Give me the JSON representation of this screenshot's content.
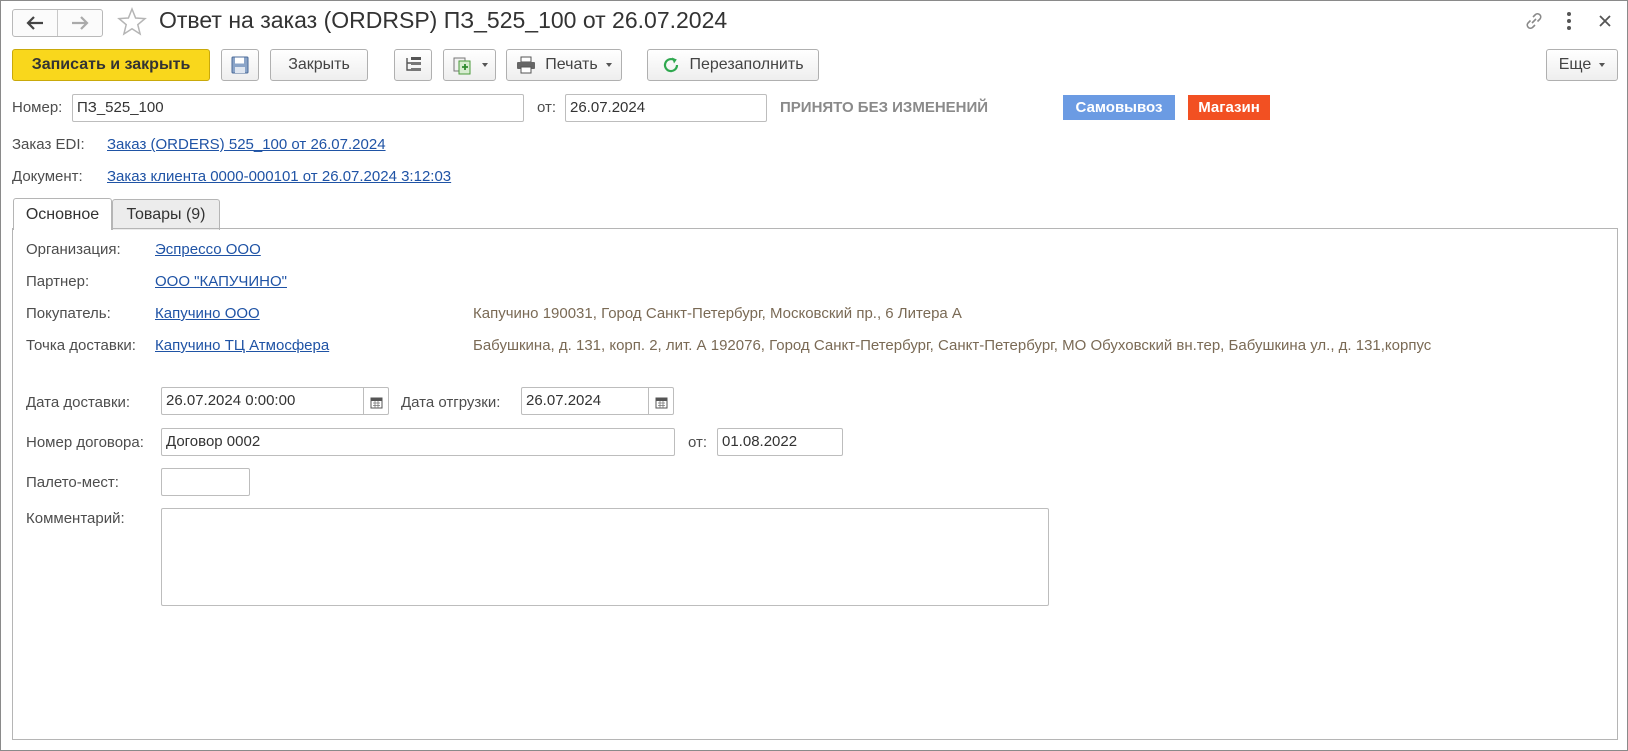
{
  "window": {
    "title": "Ответ на заказ (ORDRSP) ПЗ_525_100 от 26.07.2024",
    "more_icon": "kebab-icon",
    "close_icon": "close-icon"
  },
  "toolbar": {
    "save_close_label": "Записать и закрыть",
    "close_label": "Закрыть",
    "print_label": "Печать",
    "refill_label": "Перезаполнить",
    "more_label": "Еще"
  },
  "header": {
    "number_label": "Номер:",
    "number_value": "ПЗ_525_100",
    "date_label": "от:",
    "date_value": "26.07.2024",
    "status": "ПРИНЯТО БЕЗ ИЗМЕНЕНИЙ",
    "badges": [
      {
        "label": "Самовывоз",
        "color": "#6b9be3"
      },
      {
        "label": "Магазин",
        "color": "#f25022"
      }
    ],
    "edi_label": "Заказ EDI:",
    "edi_link": "Заказ (ORDERS) 525_100 от 26.07.2024",
    "doc_label": "Документ:",
    "doc_link": "Заказ клиента 0000-000101 от 26.07.2024 3:12:03"
  },
  "tabs": [
    {
      "label": "Основное",
      "active": true
    },
    {
      "label": "Товары (9)",
      "active": false
    }
  ],
  "main": {
    "org_label": "Организация:",
    "org_link": "Эспрессо ООО",
    "partner_label": "Партнер:",
    "partner_link": "ООО \"КАПУЧИНО\"",
    "buyer_label": "Покупатель:",
    "buyer_link": "Капучино ООО",
    "buyer_address": "Капучино 190031, Город Санкт-Петербург, Московский пр., 6 Литера А",
    "delivery_point_label": "Точка доставки:",
    "delivery_point_link": "Капучино ТЦ Атмосфера",
    "delivery_point_address": "Бабушкина, д. 131, корп. 2, лит. А 192076, Город Санкт-Петербург, Санкт-Петербург, МО Обуховский вн.тер, Бабушкина ул., д. 131,корпус",
    "delivery_date_label": "Дата доставки:",
    "delivery_date_value": "26.07.2024  0:00:00",
    "ship_date_label": "Дата отгрузки:",
    "ship_date_value": "26.07.2024",
    "contract_label": "Номер договора:",
    "contract_value": "Договор 0002",
    "contract_date_label": "от:",
    "contract_date_value": "01.08.2022",
    "pallets_label": "Палето-мест:",
    "pallets_value": "",
    "comment_label": "Комментарий:",
    "comment_value": ""
  },
  "colors": {
    "primary_button": "#f9d71c",
    "link": "#1f53a5"
  }
}
